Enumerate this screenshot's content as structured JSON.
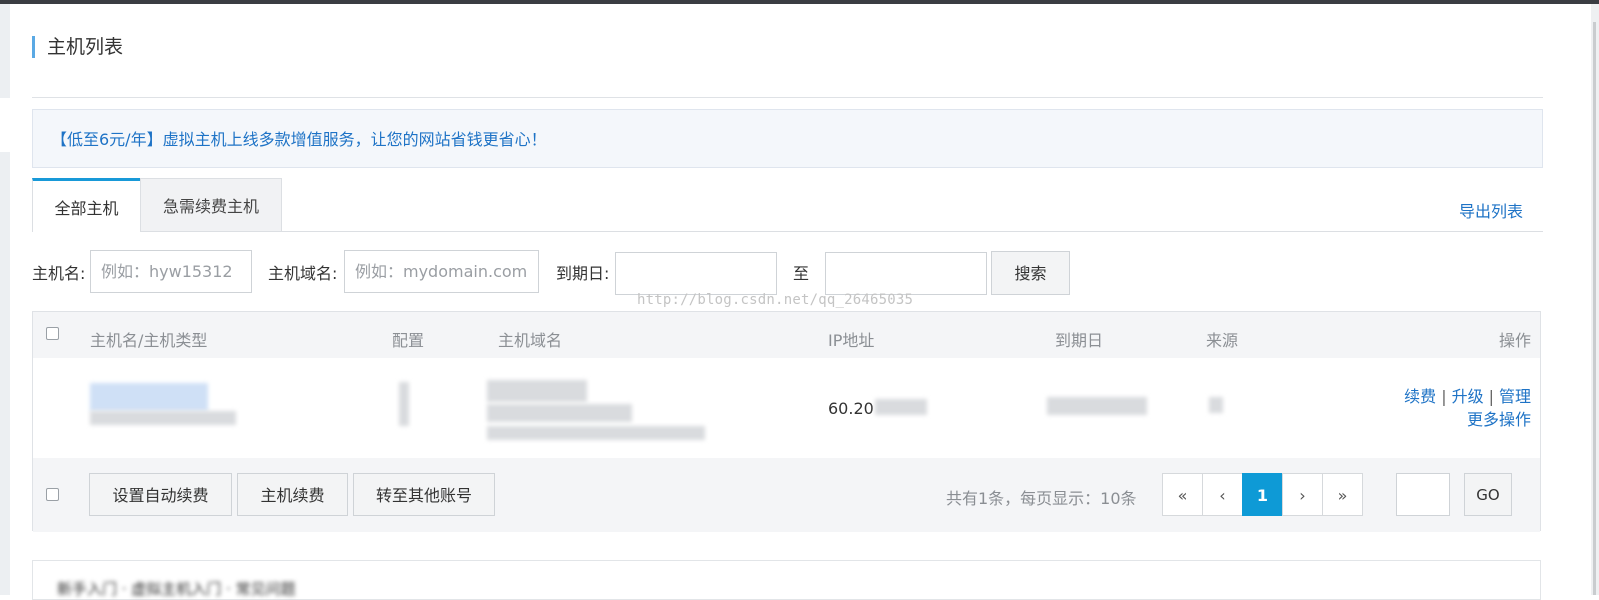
{
  "page": {
    "title": "主机列表"
  },
  "banner": {
    "text": "【低至6元/年】虚拟主机上线多款增值服务，让您的网站省钱更省心！"
  },
  "tabs": [
    {
      "label": "全部主机",
      "active": true
    },
    {
      "label": "急需续费主机",
      "active": false
    }
  ],
  "export_link": "导出列表",
  "filters": {
    "hostname_label": "主机名:",
    "hostname_placeholder": "例如：hyw15312",
    "domain_label": "主机域名:",
    "domain_placeholder": "例如：mydomain.com",
    "expiry_label": "到期日:",
    "to_label": "至",
    "search_button": "搜索"
  },
  "watermark": "http://blog.csdn.net/qq_26465035",
  "table": {
    "columns": [
      "主机名/主机类型",
      "配置",
      "主机域名",
      "IP地址",
      "到期日",
      "来源",
      "操作"
    ],
    "rows": [
      {
        "ip": "60.20",
        "actions": {
          "renew": "续费",
          "upgrade": "升级",
          "manage": "管理",
          "more": "更多操作"
        }
      }
    ]
  },
  "footer": {
    "auto_renew_button": "设置自动续费",
    "renew_button": "主机续费",
    "transfer_button": "转至其他账号",
    "summary": "共有1条，每页显示：10条",
    "pagination": {
      "first": "«",
      "prev": "‹",
      "current": "1",
      "next": "›",
      "last": "»"
    },
    "go_button": "GO"
  },
  "bottom_card": {
    "text": "新手入门 · 虚拟主机入门 · 常见问题"
  },
  "colors": {
    "accent": "#0e9ad6",
    "link": "#1e73c6",
    "title_bar": "#5aa9e4"
  }
}
